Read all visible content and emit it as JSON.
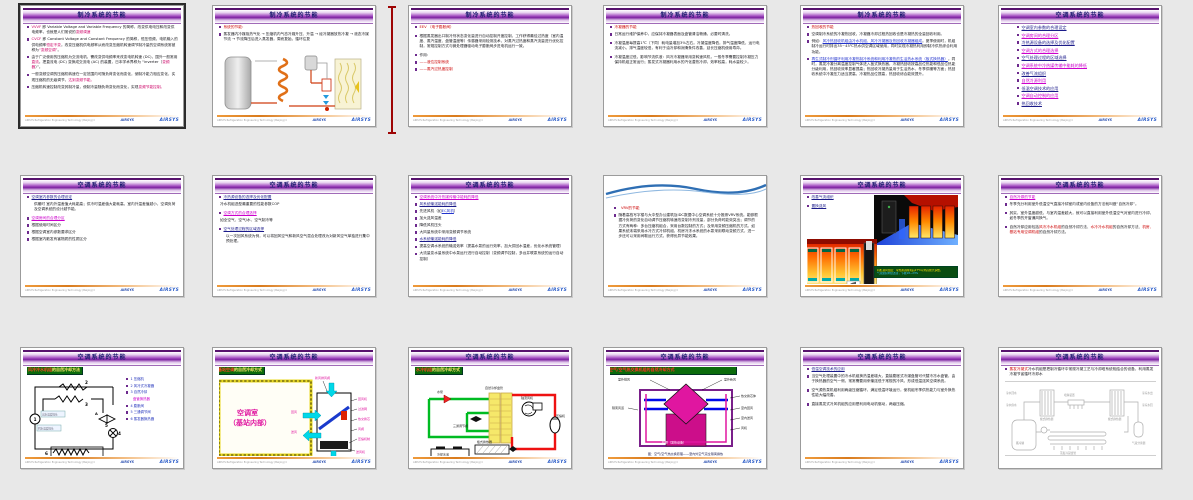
{
  "view": {
    "background": "#e8e8e8"
  },
  "footer": {
    "left": "AIRSYS Refrigeration Engineering Technology (Beijing) Co.,Ltd",
    "center": "AIRSYS",
    "right": "AIRSYS"
  },
  "slides": [
    {
      "title": "制冷系统的节能",
      "bullets": [
        {
          "parts": [
            {
              "text": "VVVF",
              "color": "#cc0066"
            },
            {
              "text": " 即 Variable Voltage and Variable Frequency 的简称，改变供电电压和改变供电频率，也就是人们常说的",
              "color": "#17171c"
            },
            {
              "text": "变频调速",
              "color": "#cc0066"
            }
          ]
        },
        {
          "parts": [
            {
              "text": "CVCF",
              "color": "#cc0066"
            },
            {
              "text": " 即 Constant Voltage and Constant Frequency 的简称，恒压恒频，电机输入的供电频率",
              "color": "#17171c"
            },
            {
              "text": "恒定不变",
              "color": "#cc0066"
            },
            {
              "text": "。改变压缩机供电频率从而改变压缩机转速调节制冷量的空调系统常被称为",
              "color": "#17171c"
            },
            {
              "text": "“变频空调”",
              "color": "#cc0066"
            },
            {
              "text": "。",
              "color": "#17171c"
            }
          ]
        },
        {
          "parts": [
            {
              "text": "由于广泛使用的压缩机为交流电机，需改变供电频率来改变电机转速 (DC)，国外一般常用",
              "color": "#17171c"
            },
            {
              "text": "直流",
              "color": "#cc0066"
            },
            {
              "text": "。把直流电 (DC) 变换成交流电 (AC) 的装置，日本学术界称为 “inverter（",
              "color": "#17171c"
            },
            {
              "text": "变频器",
              "color": "#cc0066"
            },
            {
              "text": "）”。",
              "color": "#17171c"
            }
          ]
        },
        {
          "parts": [
            {
              "text": "一般变频空调的压缩机转速在一定范围内可随负荷变化而变化，使制冷能力相应变化，实现压缩机的无级调节，",
              "color": "#17171c"
            },
            {
              "text": "达到变频节能。",
              "color": "#cc0066"
            }
          ]
        },
        {
          "parts": [
            {
              "text": "压缩机转速控制改变其制冷量，使制冷量随负荷变化而变化，实现",
              "color": "#17171c"
            },
            {
              "text": "变频节能控制。",
              "color": "#cc0066"
            }
          ]
        }
      ]
    },
    {
      "title": "制冷系统的节能",
      "bullets": [
        {
          "parts": [
            {
              "text": "系统的节能：",
              "color": "#cc0000"
            }
          ]
        },
        {
          "parts": [
            {
              "text": "蒸发器内冷媒吸热气化 → 压缩机内气态冷媒升压、升温 → 经冷凝器放热冷凝 → 液态冷媒节流 → 节流降压后进入蒸发器，周而复始，循环往复",
              "color": "#17171c"
            }
          ]
        }
      ]
    },
    {
      "title": "制冷系统的节能",
      "bullets": [
        {
          "parts": [
            {
              "text": "EEV （电子膨胀阀）",
              "color": "#cc0000"
            }
          ]
        },
        {
          "cls": "mt",
          "parts": [
            {
              "text": "根据蒸发器出口制冷剂状态变化量进行自动控制开度控制，工作获得最佳过热度（室内温度、蒸汽温度、盘管温度等）传感器采用检测技术，对蒸汽过热度和蒸汽流量进行优化控制，常规控制方式与微处理器驱动电子膨胀阀步进电机运行一致。",
              "color": "#17171c"
            }
          ]
        },
        {
          "cls": "mt",
          "parts": [
            {
              "text": "作用:",
              "color": "#17171c"
            }
          ]
        },
        {
          "parts": [
            {
              "text": "——液位控制系统",
              "color": "#cc0000"
            }
          ]
        },
        {
          "parts": [
            {
              "text": "——蒸汽过热度控制",
              "color": "#cc0000"
            }
          ]
        }
      ]
    },
    {
      "title": "制冷系统的节能",
      "bullets": [
        {
          "parts": [
            {
              "text": "冷凝器的节能",
              "color": "#cc0000"
            }
          ]
        },
        {
          "parts": [
            {
              "text": "日常运行维护保养中，应保持冷凝器表面及盘管清洁畅通，必要时清洗。",
              "color": "#17171c"
            }
          ]
        },
        {
          "cls": "mt",
          "parts": [
            {
              "text": "冷凝温度每提高1℃（下同）耗电量增加3%左右。冷凝温度降低，排气温度降低，运行电流减小。排气温度较低，有利于油冷却和润滑条件改善，延长压缩机使用寿命。",
              "color": "#17171c"
            }
          ]
        },
        {
          "cls": "mt",
          "parts": [
            {
              "text": "冷凝温度过低，影响节流供液：风冷冷凝器采用变转速风机，一般冬季需要控制冷凝压力保持机组正常运行；蒸发式冷凝器利用水的汽化潜热冷却，效率较高，耗水量较少。",
              "color": "#17171c"
            }
          ]
        }
      ]
    },
    {
      "title": "制冷系统的节能",
      "bullets": [
        {
          "parts": [
            {
              "text": "热回收的节能",
              "color": "#cc0000"
            }
          ]
        },
        {
          "parts": [
            {
              "text": "空调制冷系统的冷凝热回收，冷凝器冷却过程热回收也是冷凝热的全量回收利用。",
              "color": "#17171c"
            }
          ]
        },
        {
          "parts": [
            {
              "text": "例如：",
              "color": "#17171c"
            },
            {
              "text": "风冷热回收机组由冷水机组、风冷冷凝器及热回收冷凝器组成",
              "color": "#2233cc",
              "u": true
            },
            {
              "text": "。夏季使用时，机组制冷运行时排出35~45℃热水供空调区域使用，同时实现冷凝热利用即制冷供热综合利用功能。",
              "color": "#17171c"
            }
          ]
        },
        {
          "parts": [
            {
              "text": "再生式制冷剂循环利用冷凝热制冷系统和利用冷凝热的生活热水系统（板式换热器）",
              "color": "#2233cc",
              "u": true
            },
            {
              "text": "。同时，蒸发冷凝分离温度控制气体进入板式换热器，冷凝热回收按高品位热能和低品位热能分级利用，热回收效率显著提高；热回收冷凝热量用于生活热水、冬季供暖等方面；热回收系统中冷凝压力适当提高，冷凝热品位提高，热回收综合能效提升。",
              "color": "#17171c"
            }
          ]
        }
      ]
    },
    {
      "title": "空调系统的节能",
      "bullets": [
        {
          "size": 4.1,
          "parts": [
            {
              "text": "空调室内参数的合理设定",
              "color": "#1b1b8a",
              "u": true
            }
          ]
        },
        {
          "size": 4.1,
          "parts": [
            {
              "text": "空调房间的合理分区",
              "color": "#cc00cc",
              "u": true
            }
          ]
        },
        {
          "size": 4.1,
          "parts": [
            {
              "text": "冷热源设备的选择及优化配置",
              "color": "#1b1b8a",
              "u": true
            }
          ]
        },
        {
          "size": 4.1,
          "parts": [
            {
              "text": "空调方式的合理选择",
              "color": "#cc00cc",
              "u": true
            }
          ]
        },
        {
          "size": 4.1,
          "parts": [
            {
              "text": "空气处理过程的区域选择",
              "color": "#1b1b8a",
              "u": true
            }
          ]
        },
        {
          "size": 4.1,
          "parts": [
            {
              "text": "空调系统中冷热媒传输中能耗的降低",
              "color": "#cc00cc",
              "u": true
            }
          ]
        },
        {
          "size": 4.1,
          "parts": [
            {
              "text": "改善气流组织",
              "color": "#1b1b8a",
              "u": true
            }
          ]
        },
        {
          "size": 4.1,
          "parts": [
            {
              "text": "自然冷源利用",
              "color": "#cc00cc",
              "u": true
            }
          ]
        },
        {
          "size": 4.1,
          "parts": [
            {
              "text": "低温空调技术的应用",
              "color": "#1b1b8a",
              "u": true
            }
          ]
        },
        {
          "size": 4.1,
          "parts": [
            {
              "text": "空调自动控制的应用",
              "color": "#cc00cc",
              "u": true
            }
          ]
        },
        {
          "size": 4.1,
          "parts": [
            {
              "text": "热回收技术",
              "color": "#1b1b8a",
              "u": true
            }
          ]
        }
      ]
    },
    {
      "title": "空调系统的节能",
      "bullets": [
        {
          "parts": [
            {
              "text": "空调室内参数的合理设定",
              "color": "#1b1b8a",
              "u": true
            }
          ]
        },
        {
          "cls": "nob ind",
          "bullet": false,
          "parts": [
            {
              "text": "供暖时 室内外温差值大耗能高；供冷时温差值大能耗高，室内外温差值越小，空调负荷及空调系统的设计越节能。",
              "color": "#17171c"
            }
          ]
        },
        {
          "cls": "mt",
          "parts": [
            {
              "text": "空调房间的合理分区",
              "color": "#cc00cc",
              "u": true
            }
          ]
        },
        {
          "parts": [
            {
              "text": "根据使用时间区分",
              "color": "#17171c"
            }
          ]
        },
        {
          "parts": [
            {
              "text": "根据空调室内参数要求区分",
              "color": "#17171c"
            }
          ]
        },
        {
          "parts": [
            {
              "text": "根据室内散发有害物质的性质区分",
              "color": "#17171c"
            }
          ]
        }
      ]
    },
    {
      "title": "空调系统的节能",
      "bullets": [
        {
          "parts": [
            {
              "text": "冷热源设备的选择及优化配置",
              "color": "#1b1b8a",
              "u": true
            }
          ]
        },
        {
          "cls": "nob",
          "bullet": false,
          "parts": [
            {
              "text": "冷水机组选型最重要的性能参数COP",
              "color": "#17171c"
            }
          ]
        },
        {
          "cls": "mt",
          "parts": [
            {
              "text": "空调方式的合理选择",
              "color": "#cc00cc",
              "u": true
            }
          ]
        },
        {
          "cls": "nob",
          "bullet": false,
          "parts": [
            {
              "text": "如全空气、空气/水、空气制冷等",
              "color": "#17171c"
            }
          ]
        },
        {
          "cls": "mt",
          "parts": [
            {
              "text": "空气处理过程的区域选择",
              "color": "#1b1b8a",
              "u": true
            }
          ]
        },
        {
          "cls": "nob ind",
          "bullet": false,
          "parts": [
            {
              "text": "以一次回风系统为例，可以将回风空气和新风空气混合处理改为对新风空气单独进行集中预处理。",
              "color": "#17171c"
            }
          ]
        }
      ]
    },
    {
      "title": "空调系统的节能",
      "bullets": [
        {
          "parts": [
            {
              "text": "空调系统中冷热媒传输中能耗的降低",
              "color": "#cc00cc",
              "u": true
            }
          ]
        },
        {
          "parts": [
            {
              "text": "风系统输送能耗的降低",
              "color": "#1b1b8a",
              "u": true
            }
          ]
        },
        {
          "parts": [
            {
              "text": "先进风机（如",
              "color": "#17171c"
            },
            {
              "text": "EC风机",
              "color": "#2233cc",
              "u": true
            },
            {
              "text": "）",
              "color": "#17171c"
            }
          ]
        },
        {
          "parts": [
            {
              "text": "加大送风温差",
              "color": "#17171c"
            }
          ]
        },
        {
          "parts": [
            {
              "text": "降低风机压头",
              "color": "#17171c"
            }
          ]
        },
        {
          "parts": [
            {
              "text": "大风量系统中采用变频调节系统",
              "color": "#17171c"
            }
          ]
        },
        {
          "parts": [
            {
              "text": "水系统输送能耗的降低",
              "color": "#1b1b8a",
              "u": true
            }
          ]
        },
        {
          "parts": [
            {
              "text": "提高空调水系统的输送效率（提高水泵的运行效率，加大供回水温差，优化水系统管理）",
              "color": "#17171c"
            }
          ]
        },
        {
          "parts": [
            {
              "text": "大流量变水量系统中水泵运行进行自动控制（变频调节控制，多台并联泵系统的运行自动控制）",
              "color": "#17171c"
            }
          ]
        }
      ]
    },
    {
      "title": "",
      "bullets": [
        {
          "cls": "ind",
          "parts": [
            {
              "text": "VRV的节能",
              "color": "#cc0000"
            }
          ]
        },
        {
          "parts": [
            {
              "text": "随着高档写字楼与大中型办公建筑及IDC数据中心空调系统十分推崇VRV系统。能够根据冷负荷的变化自动调节压缩机转速改变制冷剂流量，部分负荷时能效突出；调节的方式有两种：多台压缩机组合，采用台数控制的方式；及采用变频压缩机的方式。如果系统末端采用水冷方式冷却机组，机房冷冻水系统的水泵采用联动变频方式，进一步还可以采用间歇运行方式，获得优异节能效果。",
              "color": "#17171c"
            }
          ]
        }
      ]
    },
    {
      "title": "空调系统的节能",
      "bullets": [
        {
          "parts": [
            {
              "text": "改善气流组织",
              "color": "#1b1b8a",
              "u": true
            }
          ]
        },
        {
          "cls": "mt",
          "parts": [
            {
              "text": "置换送风",
              "color": "#1b1b8a",
              "u": true
            }
          ]
        }
      ],
      "fig": {
        "caption1": "机柜进风温度：冷热通道隔离后27℃以内占绝大多数，",
        "caption2": "气流组织明显改善，节能18~23%"
      }
    },
    {
      "title": "空调系统的节能",
      "bullets": [
        {
          "parts": [
            {
              "text": "自然冷源的节能",
              "color": "#cc00cc",
              "u": true
            }
          ]
        },
        {
          "parts": [
            {
              "text": "冬季充分利用室外低温空气直接冷却室内或室内设备的方法就叫做“自然冷却”。",
              "color": "#17171c"
            }
          ]
        },
        {
          "cls": "mt",
          "parts": [
            {
              "text": "其实，室外温度越低，与室内温差越大，就可以直接利用室外低温空气对室内进行冷却，如冬季的开窗通风换气。",
              "color": "#17171c"
            }
          ]
        },
        {
          "cls": "mt",
          "parts": [
            {
              "text": "自然冷却应用包括",
              "color": "#17171c"
            },
            {
              "text": "风冷冷水机组",
              "color": "#cc0000"
            },
            {
              "text": "的自然冷却方法、",
              "color": "#17171c"
            },
            {
              "text": "水冷冷水机组",
              "color": "#cc0000"
            },
            {
              "text": "的自然冷却方法、",
              "color": "#17171c"
            },
            {
              "text": "机房、基站专用空调机组",
              "color": "#cc0000"
            },
            {
              "text": "的自然冷却方法。",
              "color": "#17171c"
            }
          ]
        }
      ]
    },
    {
      "title": "空调系统的节能",
      "fig": {
        "label1": "风冷冷水机组",
        "label2": "的自然冷却方法",
        "nums": [
          "1",
          "2",
          "3",
          "4",
          "5",
          "6",
          "A"
        ],
        "boxlabels": [
          "出水温度探头",
          "回水温度探头"
        ],
        "legend": [
          {
            "size": 3.4,
            "parts": [
              {
                "text": "1 压缩机",
                "color": "#2233bb"
              }
            ]
          },
          {
            "size": 3.4,
            "parts": [
              {
                "text": "2 风冷式冷凝器",
                "color": "#2233bb"
              }
            ]
          },
          {
            "size": 3.4,
            "parts": [
              {
                "text": "3 自然冷却",
                "color": "#2233bb"
              }
            ]
          },
          {
            "size": 3.4,
            "cls": "nob ind",
            "bullet": false,
            "parts": [
              {
                "text": "盘管换热器",
                "color": "#cc00cc"
              }
            ]
          },
          {
            "size": 3.4,
            "parts": [
              {
                "text": "4 膨胀阀",
                "color": "#2233bb"
              }
            ]
          },
          {
            "size": 3.4,
            "parts": [
              {
                "text": "5 三通调节阀",
                "color": "#2233bb"
              }
            ]
          },
          {
            "size": 3.4,
            "parts": [
              {
                "text": "6 蒸发器换热器",
                "color": "#2233bb"
              }
            ]
          }
        ]
      }
    },
    {
      "title": "空调系统的节能",
      "fig": {
        "label1": "基站空调",
        "label2": "的自然冷却方式",
        "room1": "空调室",
        "room2": "（基站内部）",
        "labels": [
          "新风排风阀",
          "回风机",
          "过滤网",
          "热交换芯体",
          "风阀",
          "压缩机制冷段",
          "送风机",
          "回风",
          "送风",
          "新风"
        ]
      }
    },
    {
      "title": "空调系统的节能",
      "fig": {
        "label1": "水冷机组",
        "label2": "的自然冷却方式",
        "labels": [
          "水泵",
          "自然冷却盘管",
          "轴流风机",
          "压缩机",
          "三通调节阀",
          "板式换热器",
          "冷却水池"
        ]
      }
    },
    {
      "title": "空调系统的节能",
      "fig": {
        "banner": "空气/空气热交换机组的自然冷却方式",
        "labels": [
          "室外排风",
          "室外新风",
          "热交换芯体",
          "室内回风",
          "室内送风",
          "风机",
          "机柜（发热设备）",
          "隔离风道"
        ],
        "caption": "图：空气/空气热交换原理——室内外空气完全隔离换热"
      }
    },
    {
      "title": "空调系统的节能",
      "bullets": [
        {
          "parts": [
            {
              "text": "低温空调技术的应用",
              "color": "#1b1b8a",
              "u": true
            }
          ]
        },
        {
          "parts": [
            {
              "text": "当空气处理装置中的冷水机组换热温差增大，直接膨胀式冷媒盘管可代替冷冻水盘管，由于换热器的空气一侧，常常需要用来输送低于常规的冷风，形成低温送风空调系统。",
              "color": "#17171c"
            }
          ]
        },
        {
          "cls": "mt",
          "parts": [
            {
              "text": "空气源热泵机组利用两级压缩循环，满足低温环境运行，使机组冬季供热能力与室外换热性能大幅改善。",
              "color": "#17171c"
            }
          ]
        },
        {
          "cls": "mt",
          "parts": [
            {
              "text": "直接蒸发式冷风机组的应用是利用电动机驱动，两级压缩。",
              "color": "#17171c"
            }
          ]
        }
      ]
    },
    {
      "title": "空调系统的节能",
      "bullets": [
        {
          "parts": [
            {
              "text": "蒸发冷凝式",
              "color": "#cc0000"
            },
            {
              "text": "冷水机组是把制冷循环中常规冷凝工艺与冷却塔系统相结合的设备，利用蒸发冷凝节省循环冷却水",
              "color": "#17171c"
            }
          ]
        }
      ],
      "fig": {
        "labels": [
          "冷水回水",
          "冷水供水",
          "蓄冷罐",
          "板式换热器",
          "喷淋装置",
          "板式换热器",
          "冷冻水出",
          "冷冻水回",
          "气液分离器",
          "蒸发冷凝盘管"
        ]
      }
    }
  ]
}
